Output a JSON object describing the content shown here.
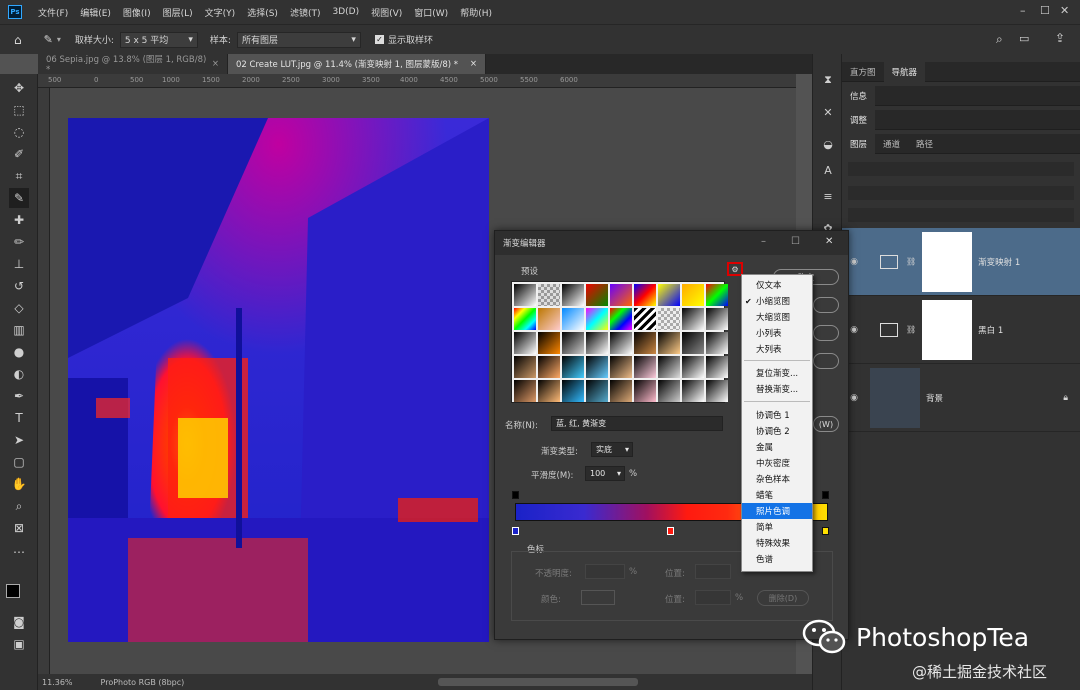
{
  "app": {
    "logo": "Ps",
    "menus": [
      "文件(F)",
      "编辑(E)",
      "图像(I)",
      "图层(L)",
      "文字(Y)",
      "选择(S)",
      "滤镜(T)",
      "3D(D)",
      "视图(V)",
      "窗口(W)",
      "帮助(H)"
    ]
  },
  "options": {
    "sample_size_label": "取样大小:",
    "sample_size_value": "5 x 5 平均",
    "sample_label": "样本:",
    "sample_value": "所有图层",
    "show_ring_label": "显示取样环"
  },
  "tabs": [
    {
      "label": "06 Sepia.jpg @ 13.8% (图层 1, RGB/8) *"
    },
    {
      "label": "02 Create LUT.jpg @ 11.4% (渐变映射 1, 图层蒙版/8) *"
    }
  ],
  "ruler": {
    "h": [
      "500",
      "0",
      "500",
      "1000",
      "1500",
      "2000",
      "2500",
      "3000",
      "3500",
      "4000",
      "4500",
      "5000",
      "5500",
      "6000"
    ]
  },
  "status": {
    "zoom": "11.36%",
    "profile": "ProPhoto RGB (8bpc)"
  },
  "panels": {
    "row1": [
      "直方图",
      "导航器"
    ],
    "info": "信息",
    "adjust": "调整",
    "layers_tabs": [
      "图层",
      "通道",
      "路径"
    ],
    "layers": [
      {
        "name": "渐变映射 1"
      },
      {
        "name": "黑白 1"
      },
      {
        "name": "背景"
      }
    ]
  },
  "dialog": {
    "title": "渐变编辑器",
    "presets_label": "预设",
    "ok": "确定",
    "name_label": "名称(N):",
    "name_value": "蓝, 红, 黄渐变",
    "type_label": "渐变类型:",
    "type_value": "实底",
    "smooth_label": "平滑度(M):",
    "smooth_value": "100",
    "percent": "%",
    "stops_label": "色标",
    "opacity_label": "不透明度:",
    "position_label": "位置:",
    "color_label": "颜色:",
    "delete_label": "删除(D)",
    "partial_w": "(W)"
  },
  "context_menu": {
    "items": [
      "仅文本",
      "小缩览图",
      "大缩览图",
      "小列表",
      "大列表",
      "复位渐变...",
      "替换渐变...",
      "协调色 1",
      "协调色 2",
      "金属",
      "中灰密度",
      "杂色样本",
      "蜡笔",
      "照片色调",
      "简单",
      "特殊效果",
      "色谱"
    ],
    "checked": "小缩览图",
    "highlighted": "照片色调"
  },
  "watermark": {
    "brand": "PhotoshopTea",
    "site": "@稀土掘金技术社区"
  },
  "colors": {
    "accent": "#1473e6",
    "layer_selected": "#4c6b8a"
  }
}
